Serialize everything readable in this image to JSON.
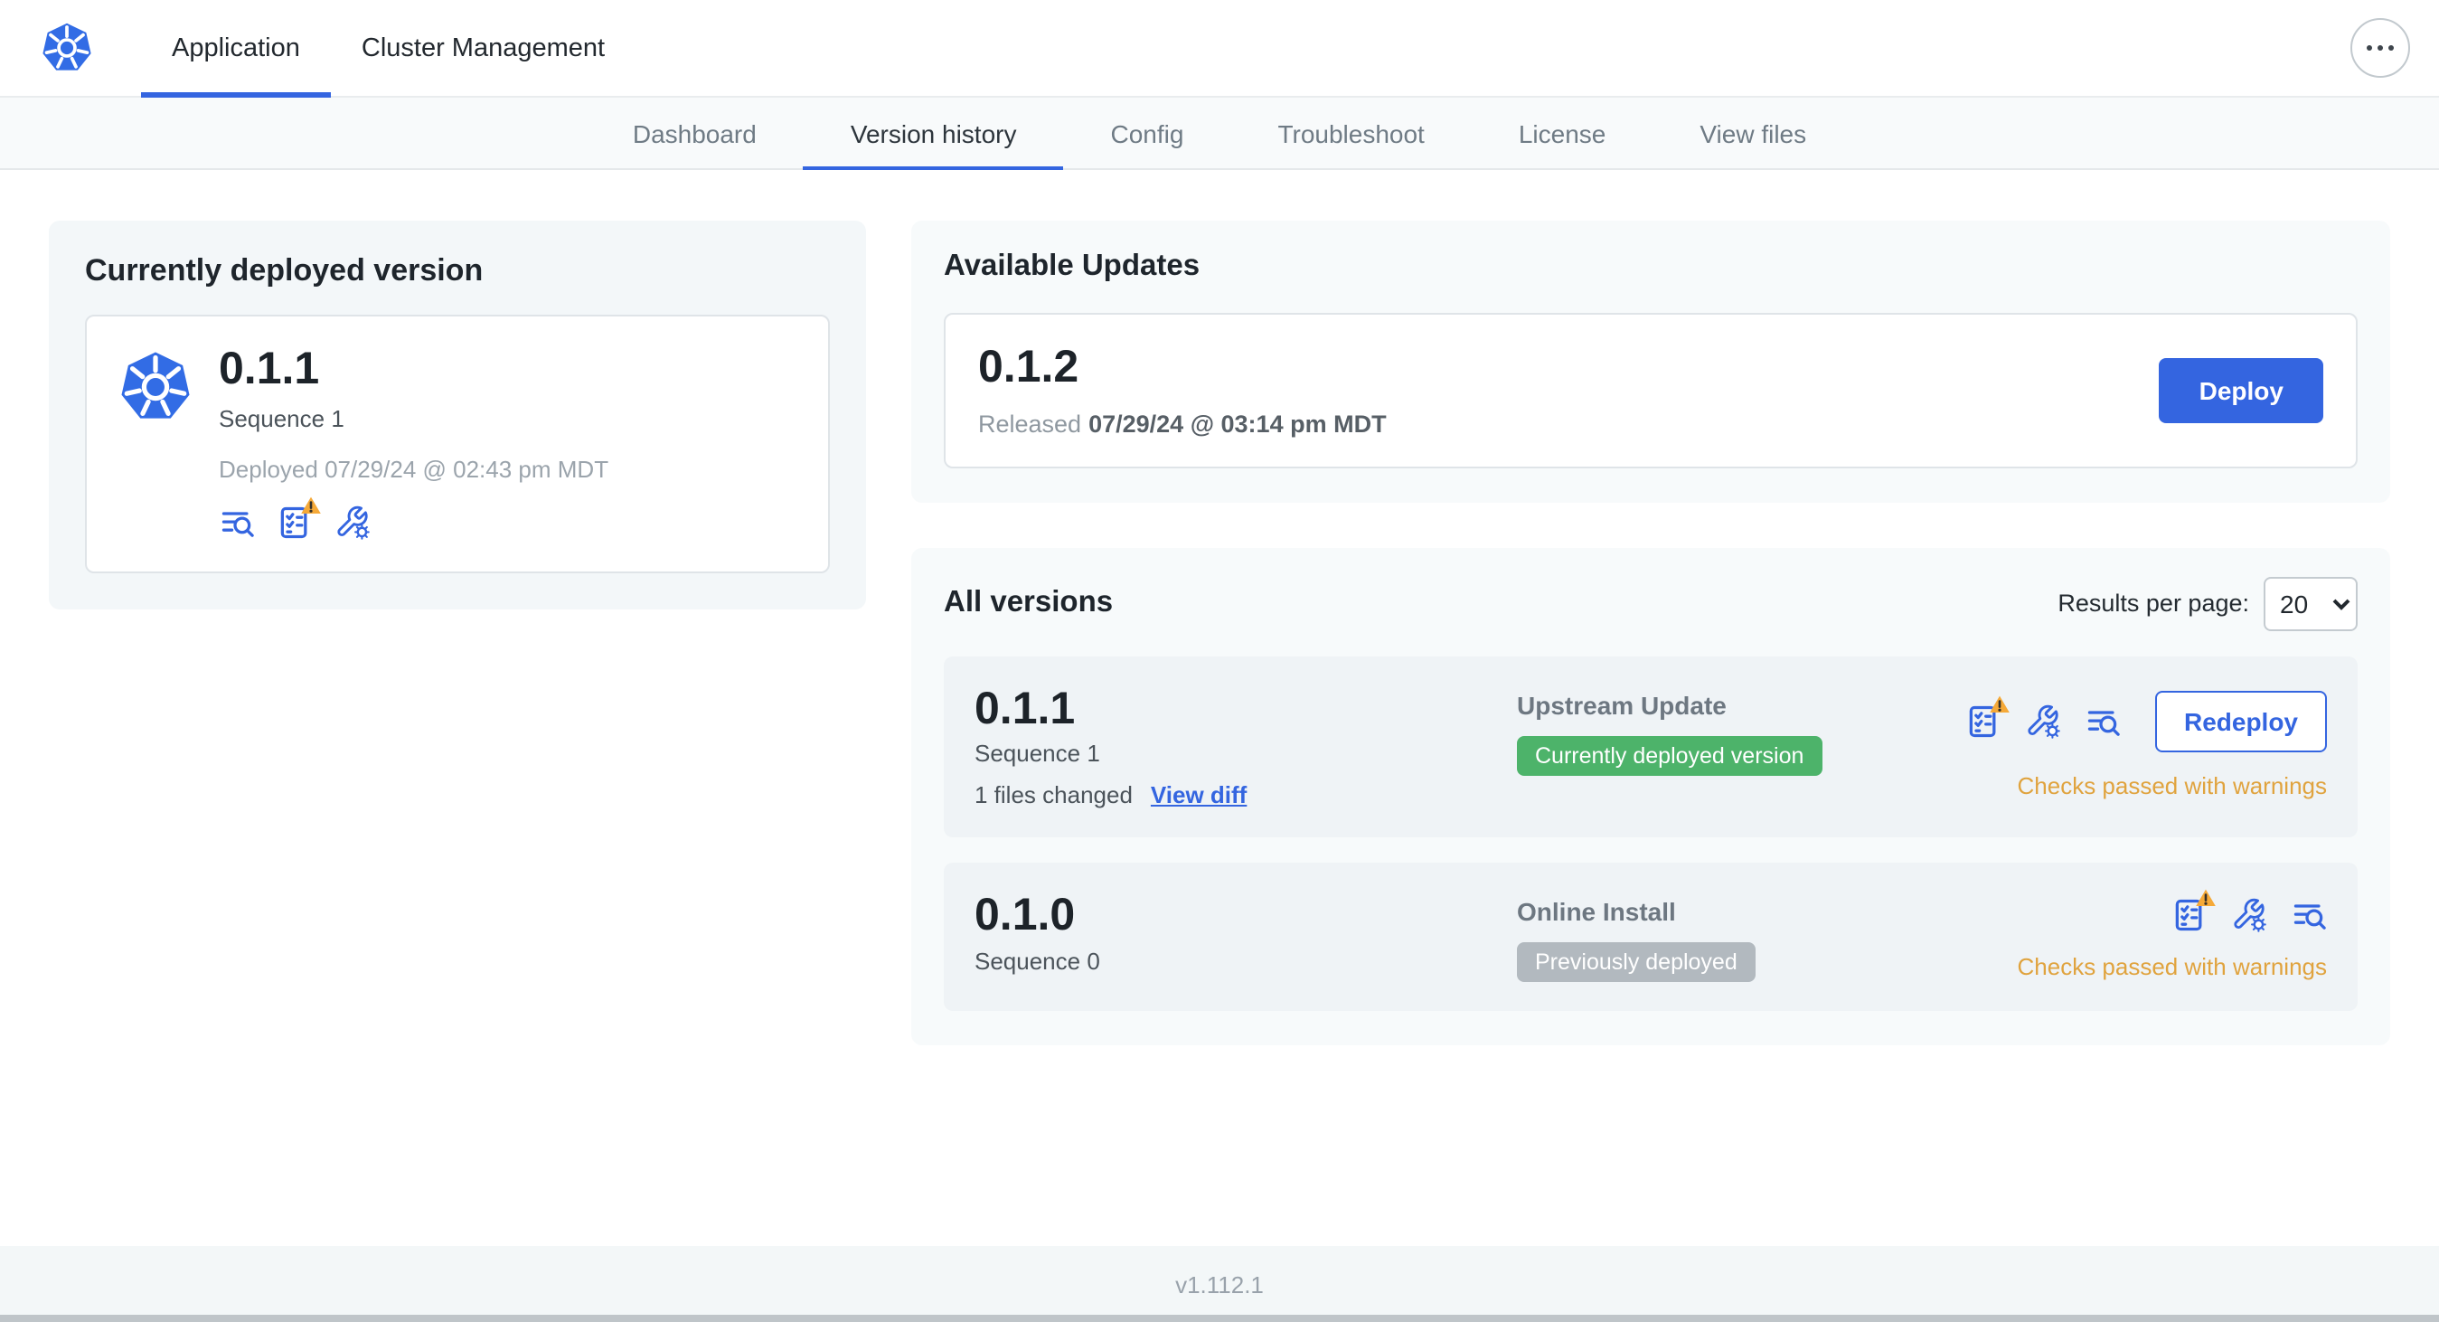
{
  "topnav": {
    "tabs": [
      {
        "label": "Application",
        "active": true
      },
      {
        "label": "Cluster Management",
        "active": false
      }
    ]
  },
  "subnav": {
    "tabs": [
      {
        "label": "Dashboard",
        "active": false
      },
      {
        "label": "Version history",
        "active": true
      },
      {
        "label": "Config",
        "active": false
      },
      {
        "label": "Troubleshoot",
        "active": false
      },
      {
        "label": "License",
        "active": false
      },
      {
        "label": "View files",
        "active": false
      }
    ]
  },
  "current": {
    "title": "Currently deployed version",
    "version": "0.1.1",
    "sequence": "Sequence 1",
    "deployed": "Deployed 07/29/24 @ 02:43 pm MDT"
  },
  "updates": {
    "title": "Available Updates",
    "version": "0.1.2",
    "released_label": "Released",
    "released_date": "07/29/24 @ 03:14 pm MDT",
    "deploy_label": "Deploy"
  },
  "versions": {
    "title": "All versions",
    "results_label": "Results per page:",
    "per_page": "20",
    "rows": [
      {
        "version": "0.1.1",
        "sequence": "Sequence 1",
        "files_changed": "1 files changed",
        "view_diff": "View diff",
        "source": "Upstream Update",
        "badge": "Currently deployed version",
        "badge_type": "green",
        "action": "Redeploy",
        "checks": "Checks passed with warnings"
      },
      {
        "version": "0.1.0",
        "sequence": "Sequence 0",
        "source": "Online Install",
        "badge": "Previously deployed",
        "badge_type": "gray",
        "checks": "Checks passed with warnings"
      }
    ]
  },
  "footer": {
    "app_version": "v1.112.1"
  },
  "icons": {
    "logo": "kubernetes-helm-logo",
    "menu": "ellipsis-icon",
    "logs": "logs-search-icon",
    "preflight": "preflight-checklist-warning-icon",
    "config": "config-wrench-gear-icon",
    "select_caret": "chevron-down-icon"
  },
  "colors": {
    "primary_blue": "#3465e0",
    "k8s_blue": "#326ce5",
    "badge_green": "#4db36a",
    "badge_gray": "#b2b9bf",
    "warning_text": "#e0a33e",
    "warning_triangle": "#f5a938",
    "active_tab_underline": "#3465e0"
  }
}
